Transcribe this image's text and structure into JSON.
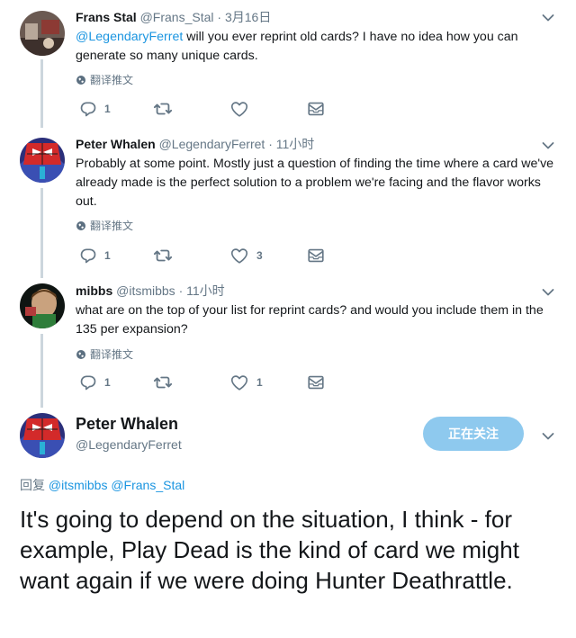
{
  "tweets": [
    {
      "name": "Frans Stal",
      "handle": "@Frans_Stal",
      "separator": "·",
      "time": "3月16日",
      "mention": "@LegendaryFerret",
      "text": " will you ever reprint old cards? I have no idea how you can generate so many unique cards.",
      "translate": "翻译推文",
      "reply_count": "1",
      "retweet_count": "",
      "like_count": ""
    },
    {
      "name": "Peter Whalen",
      "handle": "@LegendaryFerret",
      "separator": "·",
      "time": "11小时",
      "text": "Probably at some point.  Mostly just a question of finding the time where a card we've already made is the perfect solution to a problem we're facing and the flavor works out.",
      "translate": "翻译推文",
      "reply_count": "1",
      "retweet_count": "",
      "like_count": "3"
    },
    {
      "name": "mibbs",
      "handle": "@itsmibbs",
      "separator": "·",
      "time": "11小时",
      "text": "what are on the top of your list for reprint cards? and would you include them in the 135 per expansion?",
      "translate": "翻译推文",
      "reply_count": "1",
      "retweet_count": "",
      "like_count": "1"
    }
  ],
  "main": {
    "name": "Peter Whalen",
    "handle": "@LegendaryFerret",
    "follow_label": "正在关注",
    "reply_prefix": "回复",
    "reply_mentions": "@itsmibbs @Frans_Stal",
    "text": "It's going to depend on the situation, I think - for example, Play Dead is the kind of card we might want again if we were doing Hunter Deathrattle."
  },
  "icons": [
    "reply-icon",
    "retweet-icon",
    "like-icon",
    "dm-icon",
    "globe-icon",
    "chevron-down-icon"
  ],
  "colors": {
    "link": "#1b95e0",
    "muted": "#657786",
    "thread_line": "#ccd6dd",
    "follow_button": "#8ec9ee"
  }
}
